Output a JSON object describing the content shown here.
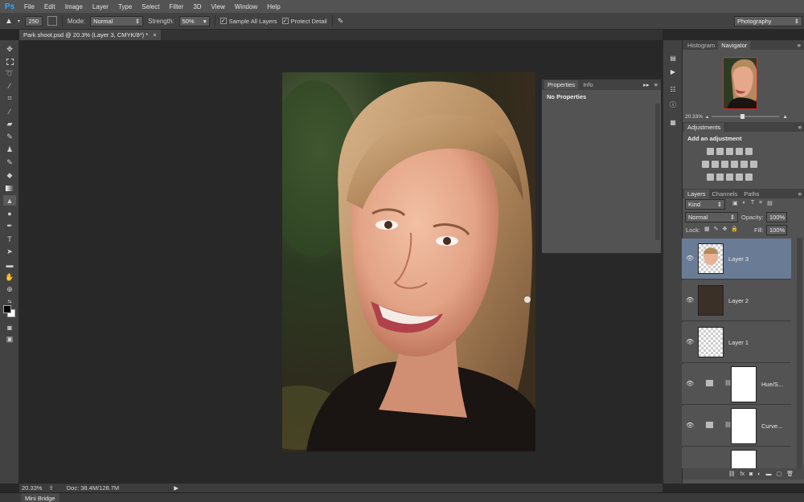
{
  "app": {
    "logo": "Ps",
    "workspace": "Photography"
  },
  "menu": [
    "File",
    "Edit",
    "Image",
    "Layer",
    "Type",
    "Select",
    "Filter",
    "3D",
    "View",
    "Window",
    "Help"
  ],
  "options": {
    "brush_size": "250",
    "mode_label": "Mode:",
    "mode_value": "Normal",
    "strength_label": "Strength:",
    "strength_value": "50%",
    "sample_all_layers": "Sample All Layers",
    "protect_detail": "Protect Detail"
  },
  "document": {
    "tab_title": "Park shoot.psd @ 20.3% (Layer 3, CMYK/8*) *",
    "close": "×"
  },
  "properties_panel": {
    "tabs": [
      "Properties",
      "Info"
    ],
    "content": "No Properties"
  },
  "right_panels": {
    "top_tabs": [
      "Histogram",
      "Navigator"
    ],
    "zoom": "20.33%",
    "adjustments_tab": "Adjustments",
    "adjustments_title": "Add an adjustment",
    "layer_tabs": [
      "Layers",
      "Channels",
      "Paths"
    ],
    "kind": "Kind",
    "blend_mode": "Normal",
    "opacity_label": "Opacity:",
    "opacity_value": "100%",
    "lock_label": "Lock:",
    "fill_label": "Fill:",
    "fill_value": "100%"
  },
  "layers": [
    {
      "name": "Layer 3",
      "selected": true
    },
    {
      "name": "Layer 2",
      "selected": false
    },
    {
      "name": "Layer 1",
      "selected": false
    },
    {
      "name": "Hue/S...",
      "selected": false
    },
    {
      "name": "Curve...",
      "selected": false
    }
  ],
  "status": {
    "zoom": "20.33%",
    "doc": "Doc: 38.4M/128.7M"
  },
  "bottom": {
    "mini_bridge": "Mini Bridge"
  }
}
